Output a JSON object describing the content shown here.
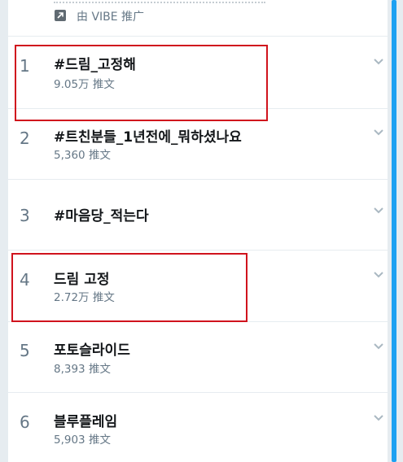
{
  "promo": {
    "icon": "promoted-arrow-icon",
    "text": "由 VIBE 推广"
  },
  "trends": [
    {
      "rank": "1",
      "title": "#드림_고정해",
      "count": "9.05万 推文"
    },
    {
      "rank": "2",
      "title": "#트친분들_1년전에_뭐하셨나요",
      "count": "5,360 推文"
    },
    {
      "rank": "3",
      "title": "#마음당_적는다",
      "count": ""
    },
    {
      "rank": "4",
      "title": "드림 고정",
      "count": "2.72万 推文"
    },
    {
      "rank": "5",
      "title": "포토슬라이드",
      "count": "8,393 推文"
    },
    {
      "rank": "6",
      "title": "블루플레임",
      "count": "5,903 推文"
    }
  ],
  "colors": {
    "highlight": "#d0131d",
    "scrollbar": "#1da1f2",
    "muted_text": "#657786"
  }
}
